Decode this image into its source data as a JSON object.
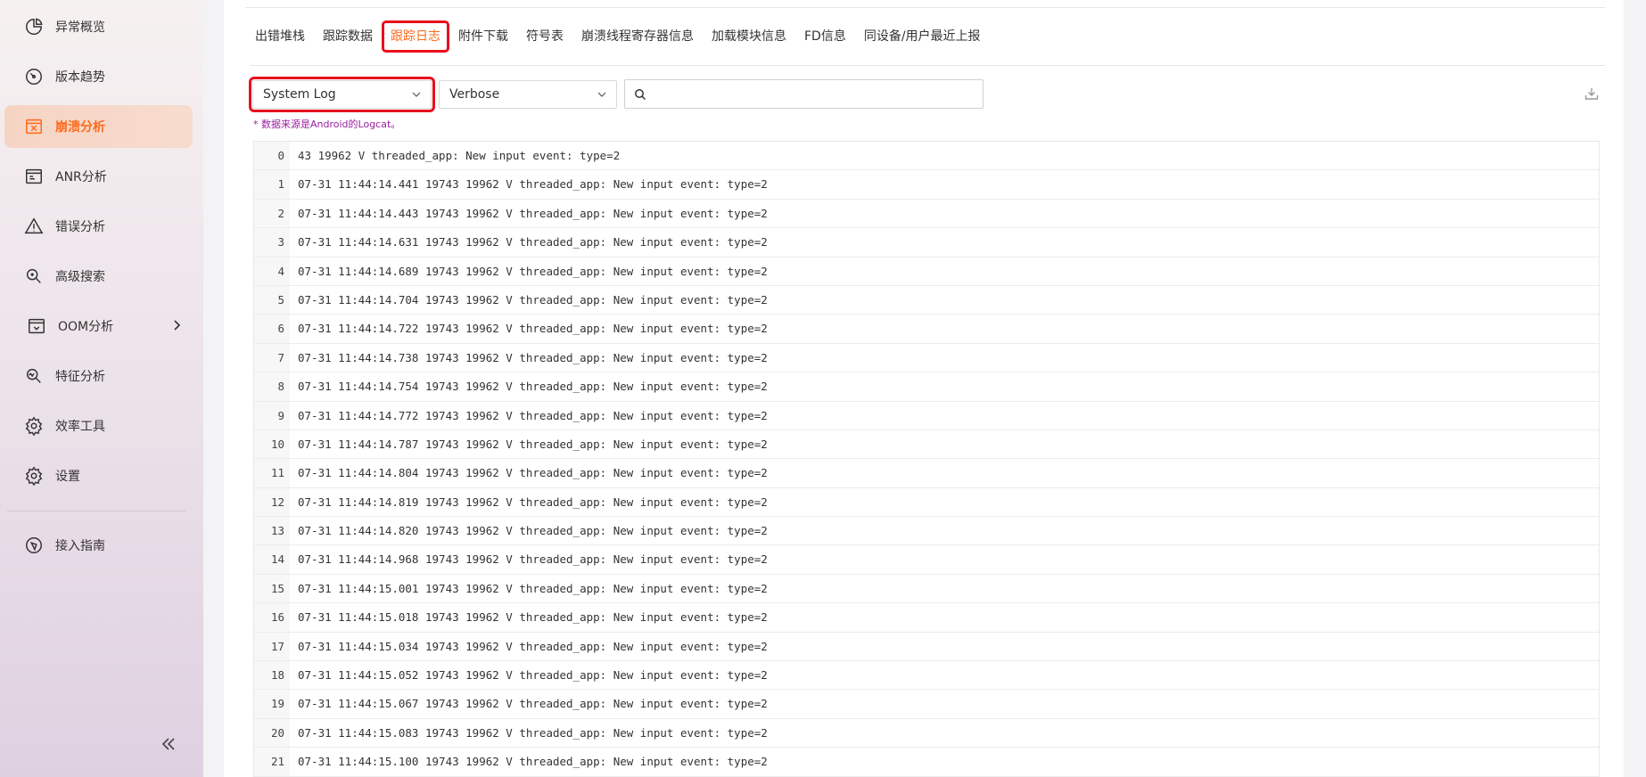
{
  "sidebar": {
    "items": [
      {
        "label": "异常概览",
        "icon": "pie-chart-icon"
      },
      {
        "label": "版本趋势",
        "icon": "gauge-icon"
      },
      {
        "label": "崩溃分析",
        "icon": "crash-window-icon",
        "active": true
      },
      {
        "label": "ANR分析",
        "icon": "browser-window-icon"
      },
      {
        "label": "错误分析",
        "icon": "warning-triangle-icon"
      },
      {
        "label": "高级搜索",
        "icon": "advanced-search-icon"
      },
      {
        "label": "OOM分析",
        "icon": "memory-window-icon",
        "has_submenu": true
      },
      {
        "label": "特征分析",
        "icon": "feature-search-icon"
      },
      {
        "label": "效率工具",
        "icon": "gear-icon"
      },
      {
        "label": "设置",
        "icon": "settings-gear-icon"
      }
    ],
    "footer_item": {
      "label": "接入指南",
      "icon": "compass-icon"
    }
  },
  "tabs": [
    "出错堆栈",
    "跟踪数据",
    "跟踪日志",
    "附件下载",
    "符号表",
    "崩溃线程寄存器信息",
    "加载模块信息",
    "FD信息",
    "同设备/用户最近上报"
  ],
  "active_tab": "跟踪日志",
  "filters": {
    "log_type": "System Log",
    "level": "Verbose",
    "search_placeholder": ""
  },
  "note": "* 数据来源是Android的Logcat。",
  "log_lines": [
    {
      "n": "0",
      "text": "43 19962 V threaded_app: New input event: type=2"
    },
    {
      "n": "1",
      "text": "07-31 11:44:14.441 19743 19962 V threaded_app: New input event: type=2"
    },
    {
      "n": "2",
      "text": "07-31 11:44:14.443 19743 19962 V threaded_app: New input event: type=2"
    },
    {
      "n": "3",
      "text": "07-31 11:44:14.631 19743 19962 V threaded_app: New input event: type=2"
    },
    {
      "n": "4",
      "text": "07-31 11:44:14.689 19743 19962 V threaded_app: New input event: type=2"
    },
    {
      "n": "5",
      "text": "07-31 11:44:14.704 19743 19962 V threaded_app: New input event: type=2"
    },
    {
      "n": "6",
      "text": "07-31 11:44:14.722 19743 19962 V threaded_app: New input event: type=2"
    },
    {
      "n": "7",
      "text": "07-31 11:44:14.738 19743 19962 V threaded_app: New input event: type=2"
    },
    {
      "n": "8",
      "text": "07-31 11:44:14.754 19743 19962 V threaded_app: New input event: type=2"
    },
    {
      "n": "9",
      "text": "07-31 11:44:14.772 19743 19962 V threaded_app: New input event: type=2"
    },
    {
      "n": "10",
      "text": "07-31 11:44:14.787 19743 19962 V threaded_app: New input event: type=2"
    },
    {
      "n": "11",
      "text": "07-31 11:44:14.804 19743 19962 V threaded_app: New input event: type=2"
    },
    {
      "n": "12",
      "text": "07-31 11:44:14.819 19743 19962 V threaded_app: New input event: type=2"
    },
    {
      "n": "13",
      "text": "07-31 11:44:14.820 19743 19962 V threaded_app: New input event: type=2"
    },
    {
      "n": "14",
      "text": "07-31 11:44:14.968 19743 19962 V threaded_app: New input event: type=2"
    },
    {
      "n": "15",
      "text": "07-31 11:44:15.001 19743 19962 V threaded_app: New input event: type=2"
    },
    {
      "n": "16",
      "text": "07-31 11:44:15.018 19743 19962 V threaded_app: New input event: type=2"
    },
    {
      "n": "17",
      "text": "07-31 11:44:15.034 19743 19962 V threaded_app: New input event: type=2"
    },
    {
      "n": "18",
      "text": "07-31 11:44:15.052 19743 19962 V threaded_app: New input event: type=2"
    },
    {
      "n": "19",
      "text": "07-31 11:44:15.067 19743 19962 V threaded_app: New input event: type=2"
    },
    {
      "n": "20",
      "text": "07-31 11:44:15.083 19743 19962 V threaded_app: New input event: type=2"
    },
    {
      "n": "21",
      "text": "07-31 11:44:15.100 19743 19962 V threaded_app: New input event: type=2"
    }
  ],
  "colors": {
    "accent": "#ff6a1a",
    "highlight_box": "#e8101c",
    "note": "#9b1fa0"
  }
}
